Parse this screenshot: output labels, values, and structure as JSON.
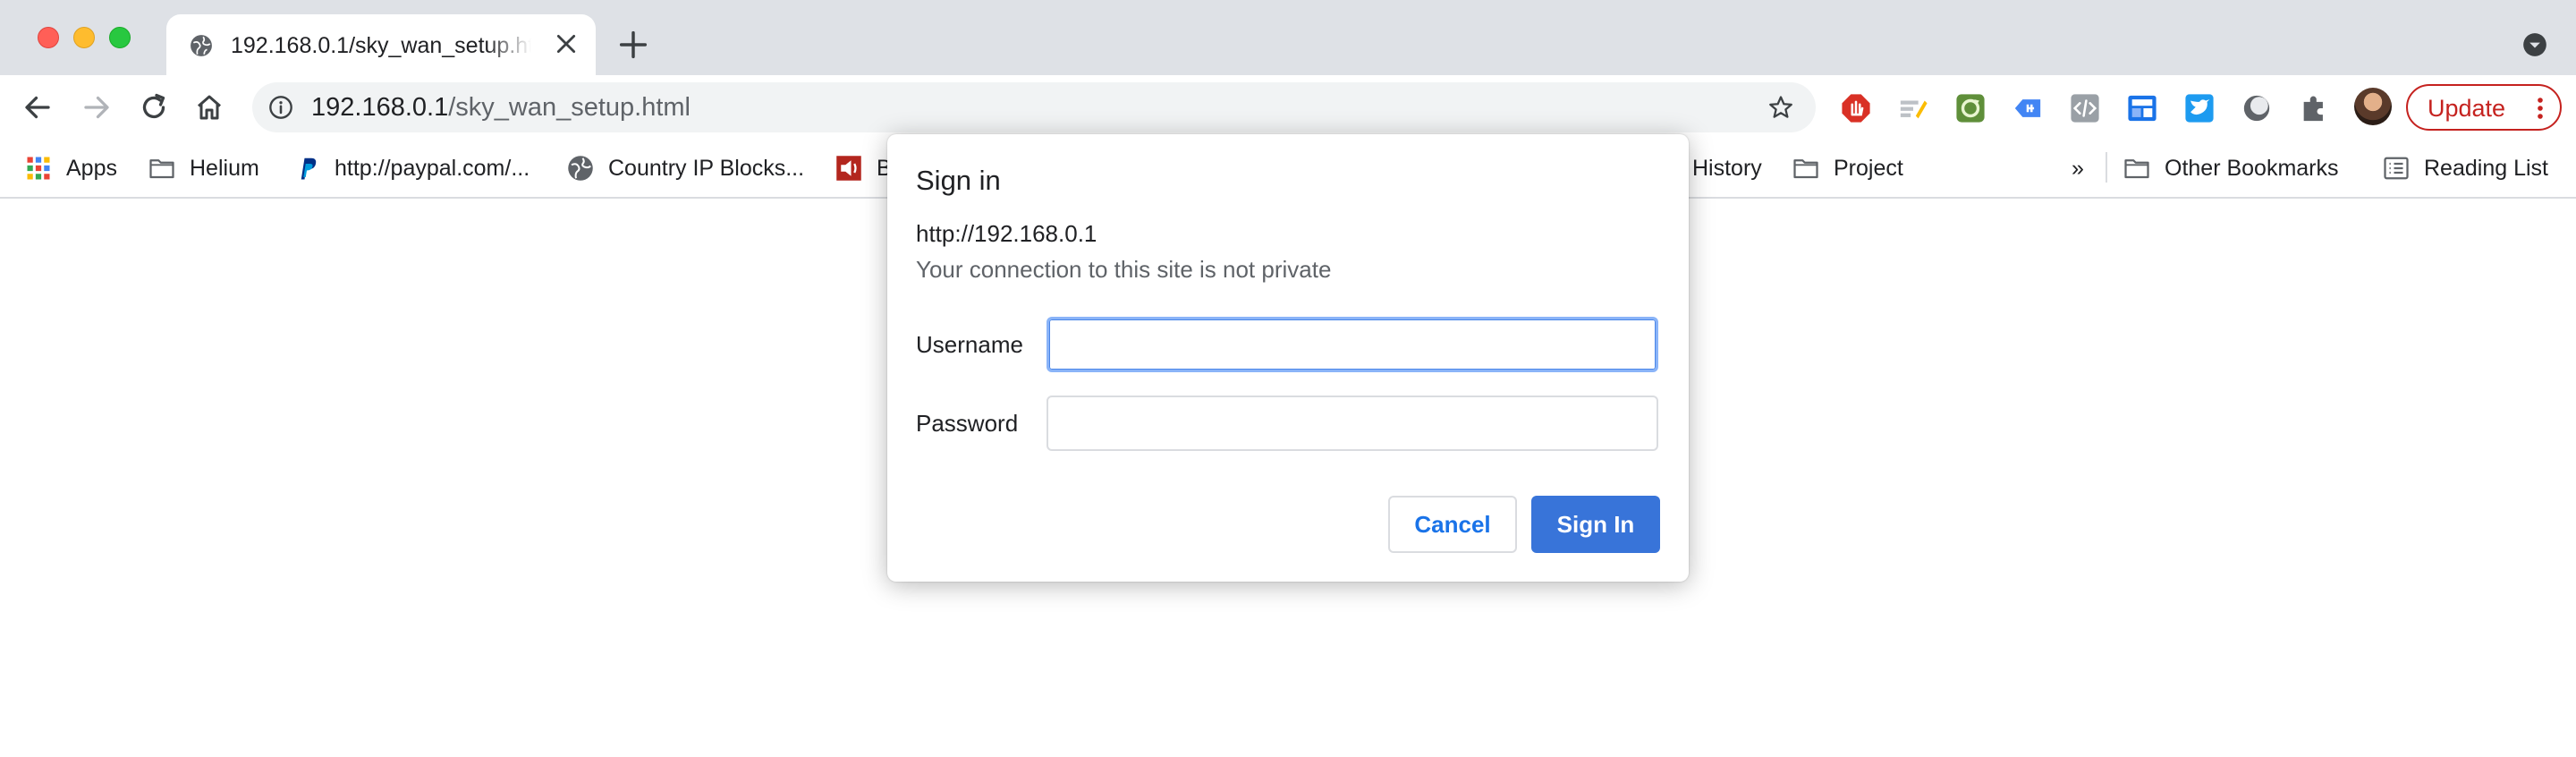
{
  "window": {
    "controls": [
      "close",
      "minimize",
      "maximize"
    ]
  },
  "tab": {
    "title": "192.168.0.1/sky_wan_setup.html",
    "favicon": "globe-icon"
  },
  "toolbar": {
    "url_host": "192.168.0.1",
    "url_path": "/sky_wan_setup.html",
    "update_label": "Update",
    "update_color": "#c5221f",
    "extensions": [
      "adblock-icon",
      "highlighter-icon",
      "refresh-ext-icon",
      "tag-ext-icon",
      "code-ext-icon",
      "layout-ext-icon",
      "bird-ext-icon",
      "dark-mode-icon",
      "puzzle-icon"
    ]
  },
  "bookmarks": {
    "items": [
      {
        "label": "Apps",
        "icon": "apps-grid-icon"
      },
      {
        "label": "Helium",
        "icon": "folder-icon"
      },
      {
        "label": "http://paypal.com/...",
        "icon": "paypal-icon"
      },
      {
        "label": "Country IP Blocks...",
        "icon": "globe-icon"
      },
      {
        "label": "B",
        "icon": "speaker-icon"
      },
      {
        "label": "History",
        "icon": ""
      },
      {
        "label": "Project",
        "icon": "folder-icon"
      }
    ],
    "overflow_label": "»",
    "other_bookmarks": "Other Bookmarks",
    "reading_list": "Reading List"
  },
  "dialog": {
    "title": "Sign in",
    "origin": "http://192.168.0.1",
    "warning": "Your connection to this site is not private",
    "username_label": "Username",
    "username_value": "",
    "password_label": "Password",
    "password_value": "",
    "cancel_label": "Cancel",
    "signin_label": "Sign In",
    "accent_color": "#3874d9"
  }
}
